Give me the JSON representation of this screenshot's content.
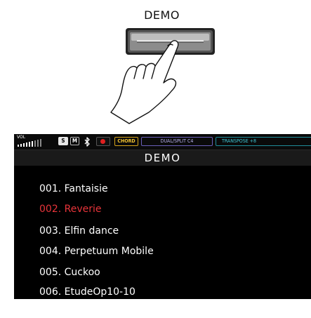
{
  "illustration": {
    "button_label": "DEMO"
  },
  "status_bar": {
    "volume_label": "VOL",
    "s_label": "S",
    "m_label": "M",
    "bluetooth_icon": "bluetooth-icon",
    "record_icon": "record-icon",
    "chord_label": "CHORD",
    "dual_split_label": "DUAL/SPLIT C4",
    "transpose_label": "TRANSPOSE +8",
    "colors": {
      "record": "#e02020",
      "chord": "#f2c232",
      "dual_split": "#b7b0ee",
      "transpose": "#3fc7d6"
    }
  },
  "screen": {
    "title": "DEMO",
    "selected_color": "#e8343a",
    "songs": [
      {
        "label": "001. Fantaisie"
      },
      {
        "label": "002. Reverie",
        "selected": true
      },
      {
        "label": "003. Elfin dance"
      },
      {
        "label": "004. Perpetuum Mobile"
      },
      {
        "label": "005. Cuckoo"
      },
      {
        "label": "006. EtudeOp10-10"
      }
    ]
  }
}
